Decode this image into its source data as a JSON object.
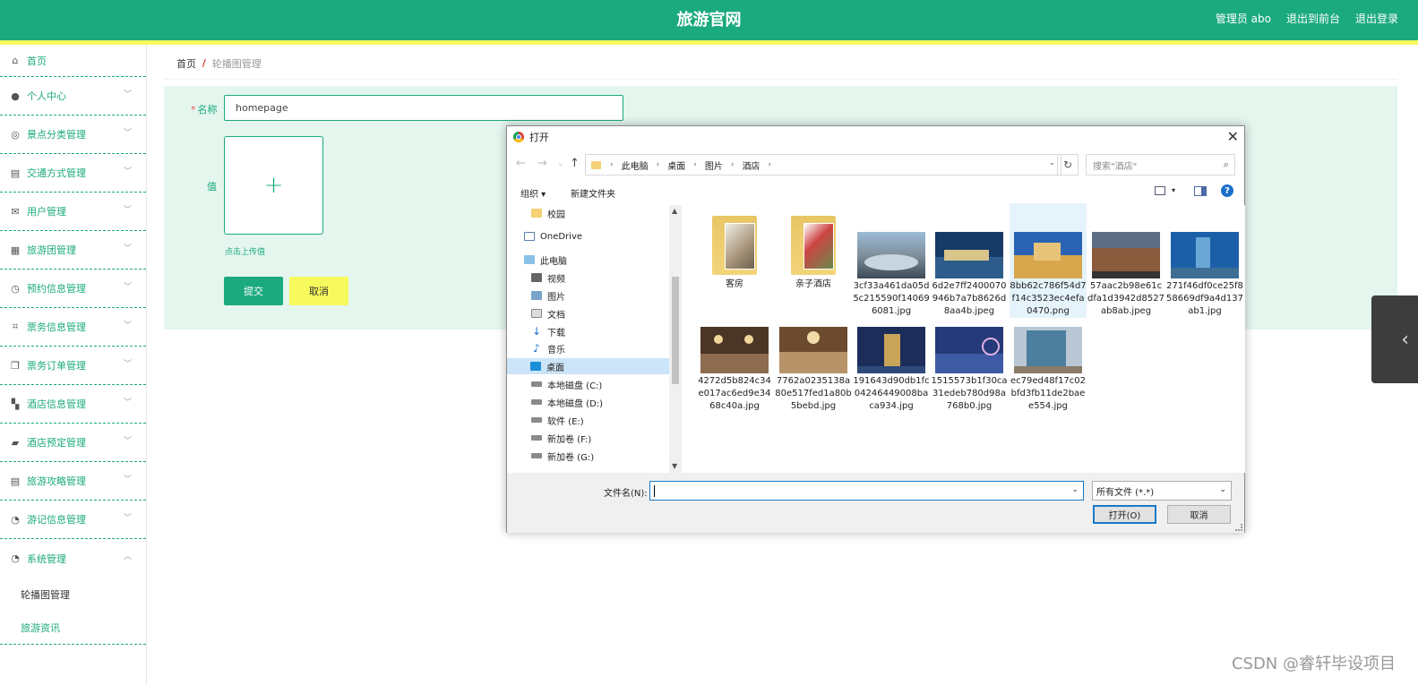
{
  "header": {
    "title": "旅游官网",
    "admin": "管理员 abo",
    "exit_front": "退出到前台",
    "logout": "退出登录"
  },
  "colors": {
    "primary": "#1baa7d",
    "accent": "#f7fa5c"
  },
  "sidebar": {
    "items": [
      {
        "label": "首页",
        "icon": "home-icon"
      },
      {
        "label": "个人中心",
        "icon": "user-icon"
      },
      {
        "label": "景点分类管理",
        "icon": "compass-icon"
      },
      {
        "label": "交通方式管理",
        "icon": "clipboard-icon"
      },
      {
        "label": "用户管理",
        "icon": "mail-icon"
      },
      {
        "label": "旅游团管理",
        "icon": "grid-icon"
      },
      {
        "label": "预约信息管理",
        "icon": "clock-icon"
      },
      {
        "label": "票务信息管理",
        "icon": "crop-icon"
      },
      {
        "label": "票务订单管理",
        "icon": "copy-icon"
      },
      {
        "label": "酒店信息管理",
        "icon": "apps-icon"
      },
      {
        "label": "酒店预定管理",
        "icon": "thumb-icon"
      },
      {
        "label": "旅游攻略管理",
        "icon": "clipboard-icon"
      },
      {
        "label": "游记信息管理",
        "icon": "gauge-icon"
      },
      {
        "label": "系统管理",
        "icon": "gauge-icon"
      }
    ],
    "sub_items": [
      {
        "label": "轮播图管理"
      },
      {
        "label": "旅游资讯"
      }
    ]
  },
  "breadcrumb": {
    "home": "首页",
    "sep": "/",
    "current": "轮播图管理"
  },
  "form": {
    "name_label": "名称",
    "name_value": "homepage",
    "value_label": "值",
    "upload_hint": "点击上传值",
    "submit": "提交",
    "cancel": "取消"
  },
  "dialog": {
    "title": "打开",
    "path": [
      "此电脑",
      "桌面",
      "图片",
      "酒店"
    ],
    "search_placeholder": "搜索\"酒店\"",
    "organize": "组织 ▾",
    "new_folder": "新建文件夹",
    "nav_tree": [
      {
        "label": "校园",
        "icon": "folder-icon"
      },
      {
        "label": "OneDrive",
        "icon": "cloud-icon"
      },
      {
        "label": "此电脑",
        "icon": "computer-icon"
      },
      {
        "label": "视频",
        "icon": "video-icon"
      },
      {
        "label": "图片",
        "icon": "picture-icon"
      },
      {
        "label": "文档",
        "icon": "document-icon"
      },
      {
        "label": "下载",
        "icon": "download-icon"
      },
      {
        "label": "音乐",
        "icon": "music-icon"
      },
      {
        "label": "桌面",
        "icon": "desktop-icon"
      },
      {
        "label": "本地磁盘 (C:)",
        "icon": "drive-icon"
      },
      {
        "label": "本地磁盘 (D:)",
        "icon": "drive-icon"
      },
      {
        "label": "软件 (E:)",
        "icon": "drive-icon"
      },
      {
        "label": "新加卷 (F:)",
        "icon": "drive-icon"
      },
      {
        "label": "新加卷 (G:)",
        "icon": "drive-icon"
      }
    ],
    "files": [
      {
        "name": "客房",
        "type": "folder"
      },
      {
        "name": "亲子酒店",
        "type": "folder"
      },
      {
        "name": "3cf33a461da05d5c215590f140696081.jpg",
        "type": "image"
      },
      {
        "name": "6d2e7ff2400070946b7a7b8626d8aa4b.jpeg",
        "type": "image"
      },
      {
        "name": "8bb62c786f54d7f14c3523ec4efa0470.png",
        "type": "image"
      },
      {
        "name": "57aac2b98e61cdfa1d3942d8527ab8ab.jpeg",
        "type": "image"
      },
      {
        "name": "271f46df0ce25f858669df9a4d137ab1.jpg",
        "type": "image"
      },
      {
        "name": "4272d5b824c34e017ac6ed9e3468c40a.jpg",
        "type": "image"
      },
      {
        "name": "7762a0235138a80e517fed1a80b5bebd.jpg",
        "type": "image"
      },
      {
        "name": "191643d90db1fc04246449008baca934.jpg",
        "type": "image"
      },
      {
        "name": "1515573b1f30ca31edeb780d98a768b0.jpg",
        "type": "image"
      },
      {
        "name": "ec79ed48f17c02bfd3fb11de2baee554.jpg",
        "type": "image"
      }
    ],
    "filename_label": "文件名(N):",
    "filename_value": "",
    "filetype": "所有文件 (*.*)",
    "open": "打开(O)",
    "cancel": "取消"
  },
  "watermark": "CSDN @睿轩毕设项目"
}
